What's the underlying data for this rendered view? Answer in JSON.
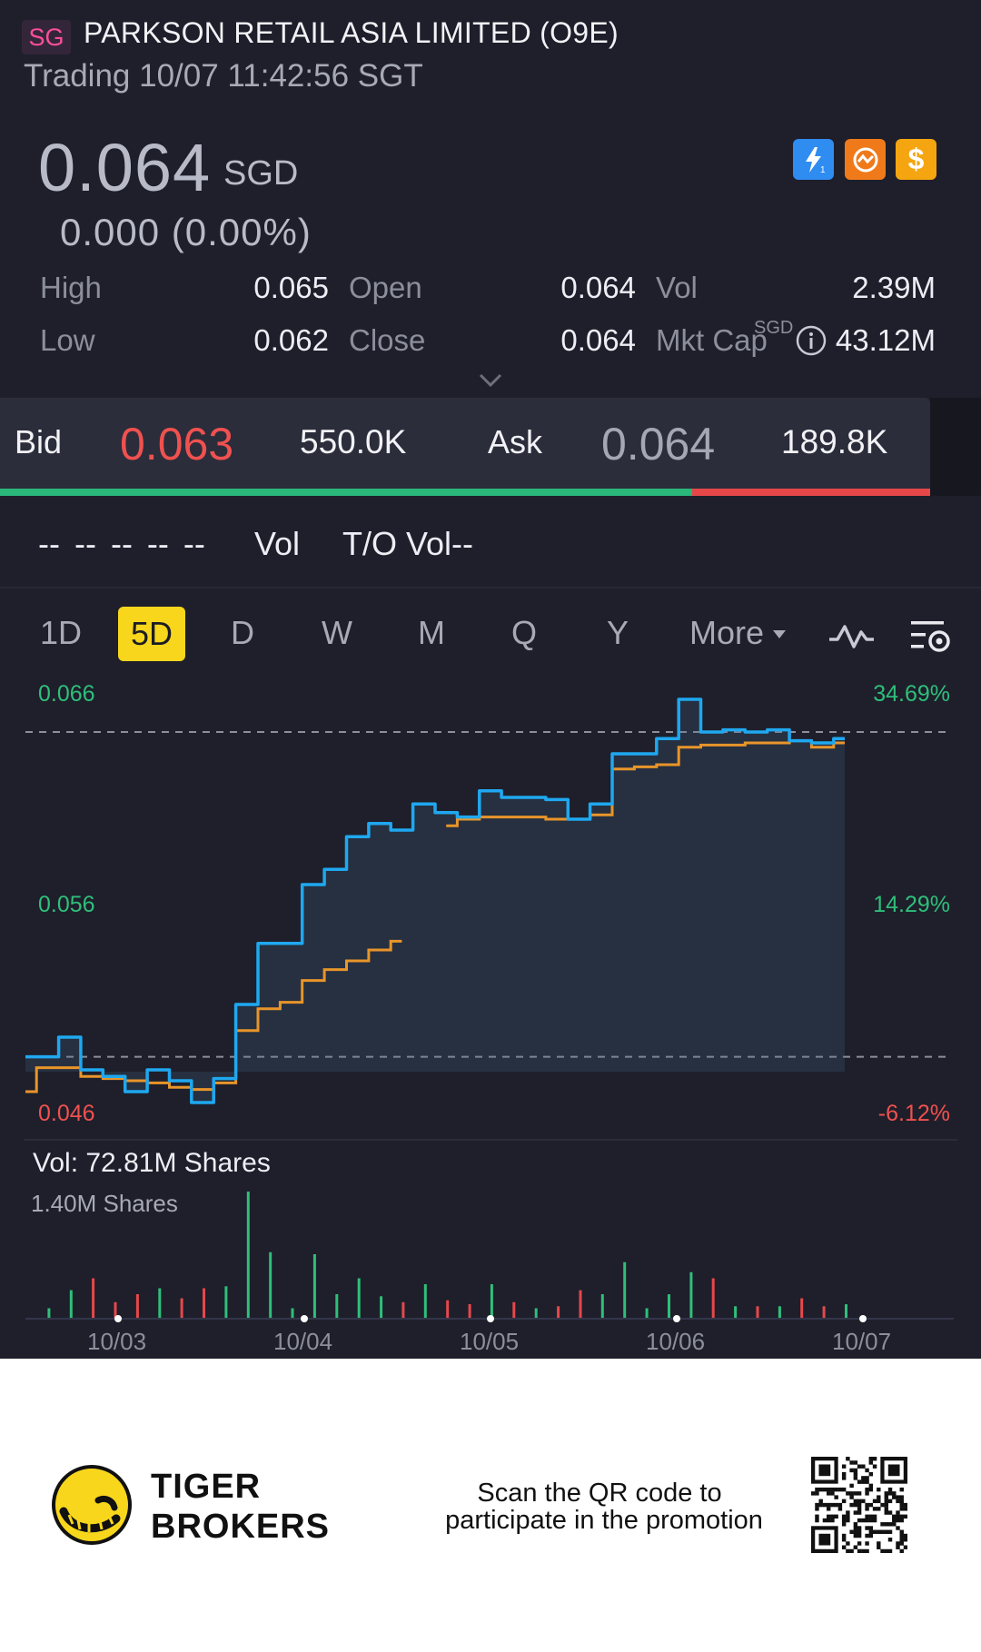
{
  "header": {
    "market_tag": "SG",
    "company_name": "PARKSON RETAIL ASIA LIMITED (O9E)",
    "status": "Trading 10/07 11:42:56 SGT"
  },
  "quote": {
    "price": "0.064",
    "currency": "SGD",
    "change": "0.000 (0.00%)",
    "badges": [
      "flash-icon",
      "swap-icon",
      "dollar-icon"
    ],
    "badge_colors": [
      "#2f8cf0",
      "#f07a1a",
      "#f5a510"
    ],
    "dollar_symbol": "$"
  },
  "stats": {
    "high_label": "High",
    "high_value": "0.065",
    "open_label": "Open",
    "open_value": "0.064",
    "vol_label": "Vol",
    "vol_value": "2.39M",
    "low_label": "Low",
    "low_value": "0.062",
    "close_label": "Close",
    "close_value": "0.064",
    "mktcap_label": "Mkt Cap",
    "mktcap_sup": "SGD",
    "mktcap_value": "43.12M"
  },
  "bidask": {
    "bid_label": "Bid",
    "bid_price": "0.063",
    "bid_size": "550.0K",
    "ask_label": "Ask",
    "ask_price": "0.064",
    "ask_size": "189.8K",
    "bid_share": 0.744
  },
  "tick_row": {
    "placeholders": "-- -- -- -- --",
    "vol_label": "Vol",
    "to_vol_label": "T/O Vol--"
  },
  "tabs": [
    {
      "label": "1D",
      "active": false
    },
    {
      "label": "5D",
      "active": true
    },
    {
      "label": "D",
      "active": false
    },
    {
      "label": "W",
      "active": false
    },
    {
      "label": "M",
      "active": false
    },
    {
      "label": "Q",
      "active": false
    },
    {
      "label": "Y",
      "active": false
    },
    {
      "label": "More",
      "active": false
    }
  ],
  "chart": {
    "y_left": [
      "0.066",
      "0.056",
      "0.046"
    ],
    "y_right": [
      "34.69%",
      "14.29%",
      "-6.12%"
    ],
    "y_left_colors": [
      "#2fbf7a",
      "#2fbf7a",
      "#f0514f"
    ],
    "y_right_colors": [
      "#2fbf7a",
      "#2fbf7a",
      "#f0514f"
    ],
    "volume_label": "Vol:  72.81M Shares",
    "volume_max": "1.40M Shares",
    "dates": [
      "10/03",
      "10/04",
      "10/05",
      "10/06",
      "10/07"
    ],
    "line_color": "#1fa8f0",
    "avg_color": "#e8952a",
    "up_color": "#2fbf7a",
    "down_color": "#e6484a"
  },
  "chart_data": {
    "type": "line",
    "x_labels": [
      "10/03",
      "10/04",
      "10/05",
      "10/06",
      "10/07"
    ],
    "ylim": [
      0.046,
      0.066
    ],
    "pct_range": [
      "-6.12%",
      "34.69%"
    ],
    "series": [
      {
        "values": [
          0.0496,
          0.0496,
          0.0505,
          0.049,
          0.0487,
          0.048,
          0.049,
          0.0485,
          0.0475,
          0.0486,
          0.052,
          0.0548,
          0.0548,
          0.0575,
          0.0582,
          0.0597,
          0.0603,
          0.06,
          0.0612,
          0.0608,
          0.0606,
          0.0618,
          0.0615,
          0.0615,
          0.0614,
          0.0605,
          0.0612,
          0.0635,
          0.0635,
          0.0642,
          0.066,
          0.0645,
          0.0646,
          0.0645,
          0.0646,
          0.0641,
          0.064,
          0.0642
        ]
      },
      {
        "values": [
          0.048,
          0.0491,
          0.0491,
          0.0487,
          0.0486,
          0.0485,
          0.0484,
          0.0482,
          0.0481,
          0.0484,
          0.0508,
          0.0518,
          0.0521,
          0.0531,
          0.0536,
          0.054,
          0.0545,
          0.0549,
          null,
          0.0602,
          0.0605,
          0.0606,
          0.0606,
          0.0606,
          0.0605,
          0.0605,
          0.0607,
          0.0628,
          0.0629,
          0.063,
          0.0638,
          0.0639,
          0.0639,
          0.064,
          0.064,
          0.0641,
          0.0638,
          0.064
        ]
      }
    ]
  },
  "footer": {
    "brand_line1": "TIGER",
    "brand_line2": "BROKERS",
    "promo_line1": "Scan the QR code to",
    "promo_line2": "participate in the promotion"
  }
}
